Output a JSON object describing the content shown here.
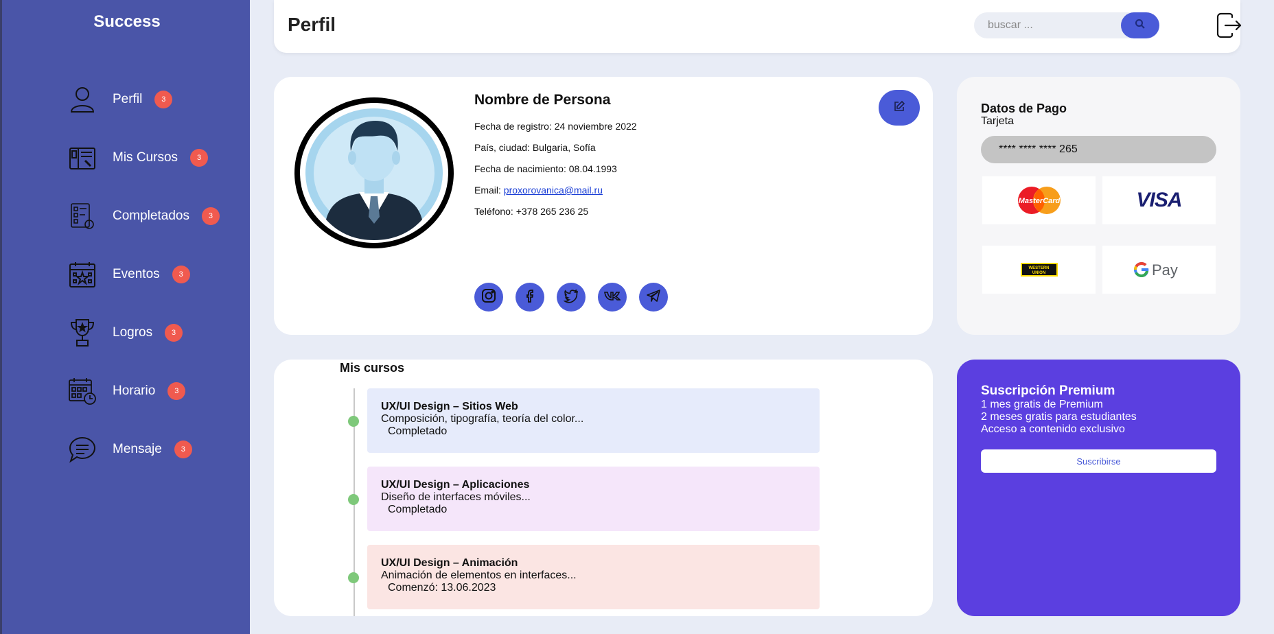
{
  "sidebar": {
    "brand": "Success",
    "items": [
      {
        "label": "Perfil",
        "badge": "3",
        "icon": "user-icon"
      },
      {
        "label": "Mis Cursos",
        "badge": "3",
        "icon": "book-icon"
      },
      {
        "label": "Completados",
        "badge": "3",
        "icon": "checklist-icon"
      },
      {
        "label": "Eventos",
        "badge": "3",
        "icon": "calendar-icon"
      },
      {
        "label": "Logros",
        "badge": "3",
        "icon": "trophy-icon"
      },
      {
        "label": "Horario",
        "badge": "3",
        "icon": "schedule-icon"
      },
      {
        "label": "Mensaje",
        "badge": "3",
        "icon": "chat-icon"
      }
    ]
  },
  "header": {
    "title": "Perfil",
    "search_placeholder": "buscar ...",
    "search_icon": "search-icon",
    "logout_icon": "logout-icon"
  },
  "profile": {
    "name": "Nombre de Persona",
    "registration_label": "Fecha de registro: ",
    "registration_date": "24 noviembre 2022",
    "location_label": "País, ciudad: ",
    "location": "Bulgaria, Sofía",
    "birth_label": "Fecha de nacimiento: ",
    "birth_date": "08.04.1993",
    "email_label": "Email: ",
    "email": "proxorovanica@mail.ru",
    "phone_label": "Teléfono: ",
    "phone": "+378 265 236 25",
    "edit_icon": "edit-icon",
    "social_icons": [
      "instagram-icon",
      "facebook-icon",
      "twitter-icon",
      "vk-icon",
      "telegram-icon"
    ]
  },
  "payment": {
    "title": "Datos de Pago",
    "subtitle": "Tarjeta",
    "card_number": "**** **** **** 265",
    "methods": [
      "MasterCard",
      "VISA",
      "WESTERN UNION",
      "G Pay"
    ]
  },
  "courses": {
    "title": "Mis cursos",
    "items": [
      {
        "title": "UX/UI Design – Sitios Web",
        "desc": "Composición, tipografía, teoría del color...",
        "status": "Completado",
        "color": "#e6ebfb"
      },
      {
        "title": "UX/UI Design – Aplicaciones",
        "desc": "Diseño de interfaces móviles...",
        "status": "Completado",
        "color": "#f5e6fa"
      },
      {
        "title": "UX/UI Design – Animación",
        "desc": "Animación de elementos en interfaces...",
        "status": "Comenzó: 13.06.2023",
        "color": "#fbe5e3"
      }
    ]
  },
  "premium": {
    "title": "Suscripción Premium",
    "lines": [
      "1 mes gratis de Premium",
      "2 meses gratis para estudiantes",
      "Acceso a contenido exclusivo"
    ],
    "button": "Suscribirse"
  },
  "colors": {
    "sidebar": "#4a55a8",
    "accent": "#4a5bd8",
    "badge": "#f05a4f",
    "premium": "#5b3fe0",
    "timeline_dot": "#7ec87a"
  }
}
